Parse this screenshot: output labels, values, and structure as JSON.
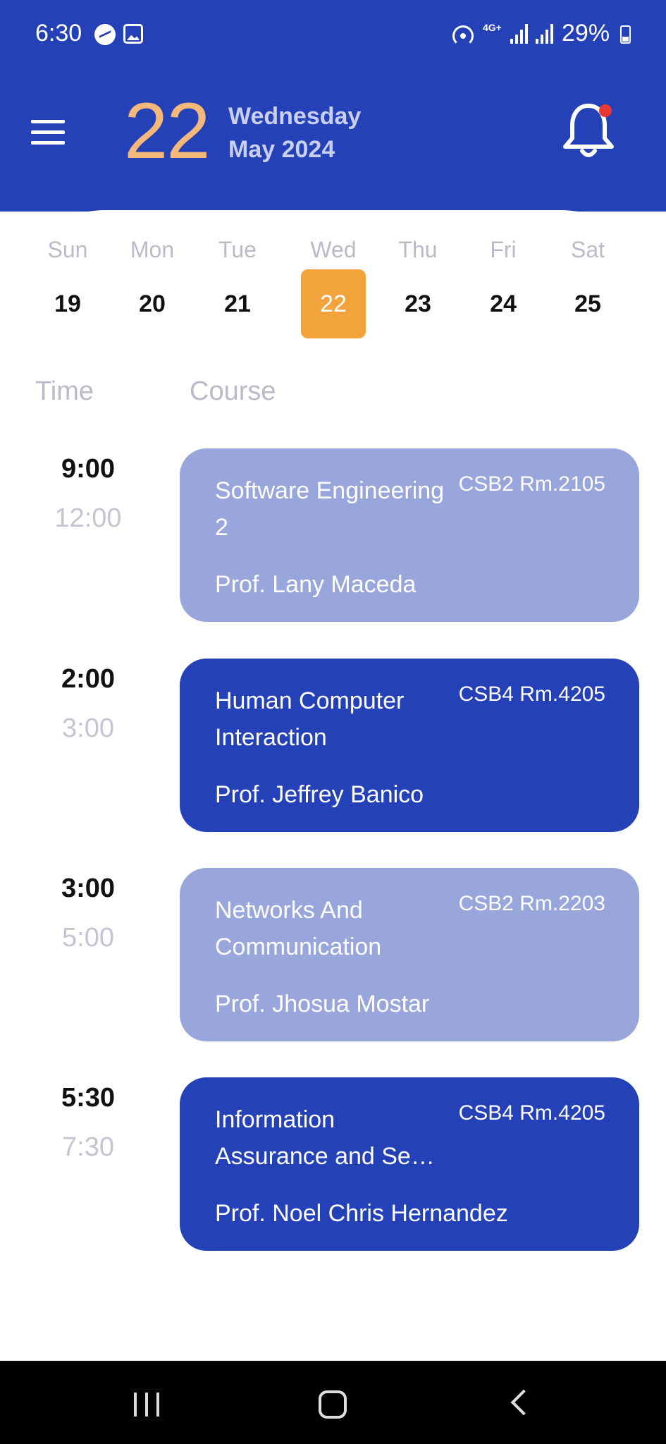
{
  "status_bar": {
    "time": "6:30",
    "network": "4G+",
    "battery": "29%",
    "icons": [
      "messenger-icon",
      "gallery-icon",
      "hotspot-icon",
      "signal-icon",
      "battery-icon"
    ]
  },
  "header": {
    "day_number": "22",
    "weekday": "Wednesday",
    "month_year": "May 2024",
    "accent_color": "#f4b87a",
    "background_color": "#2541b7",
    "notification_badge": true
  },
  "week": [
    {
      "name": "Sun",
      "date": "19",
      "selected": false
    },
    {
      "name": "Mon",
      "date": "20",
      "selected": false
    },
    {
      "name": "Tue",
      "date": "21",
      "selected": false
    },
    {
      "name": "Wed",
      "date": "22",
      "selected": true
    },
    {
      "name": "Thu",
      "date": "23",
      "selected": false
    },
    {
      "name": "Fri",
      "date": "24",
      "selected": false
    },
    {
      "name": "Sat",
      "date": "25",
      "selected": false
    }
  ],
  "columns": {
    "time": "Time",
    "course": "Course"
  },
  "schedule": [
    {
      "start": "9:00",
      "end": "12:00",
      "course": "Software Engineering 2",
      "room": "CSB2 Rm.2105",
      "professor": "Prof. Lany Maceda",
      "style": "light"
    },
    {
      "start": "2:00",
      "end": "3:00",
      "course": "Human Computer Interaction",
      "room": "CSB4 Rm.4205",
      "professor": "Prof. Jeffrey Banico",
      "style": "dark"
    },
    {
      "start": "3:00",
      "end": "5:00",
      "course": "Networks And Communication",
      "room": "CSB2 Rm.2203",
      "professor": "Prof. Jhosua Mostar",
      "style": "light"
    },
    {
      "start": "5:30",
      "end": "7:30",
      "course": "Information Assurance and Se…",
      "room": "CSB4 Rm.4205",
      "professor": "Prof. Noel Chris Hernandez",
      "style": "dark"
    }
  ]
}
